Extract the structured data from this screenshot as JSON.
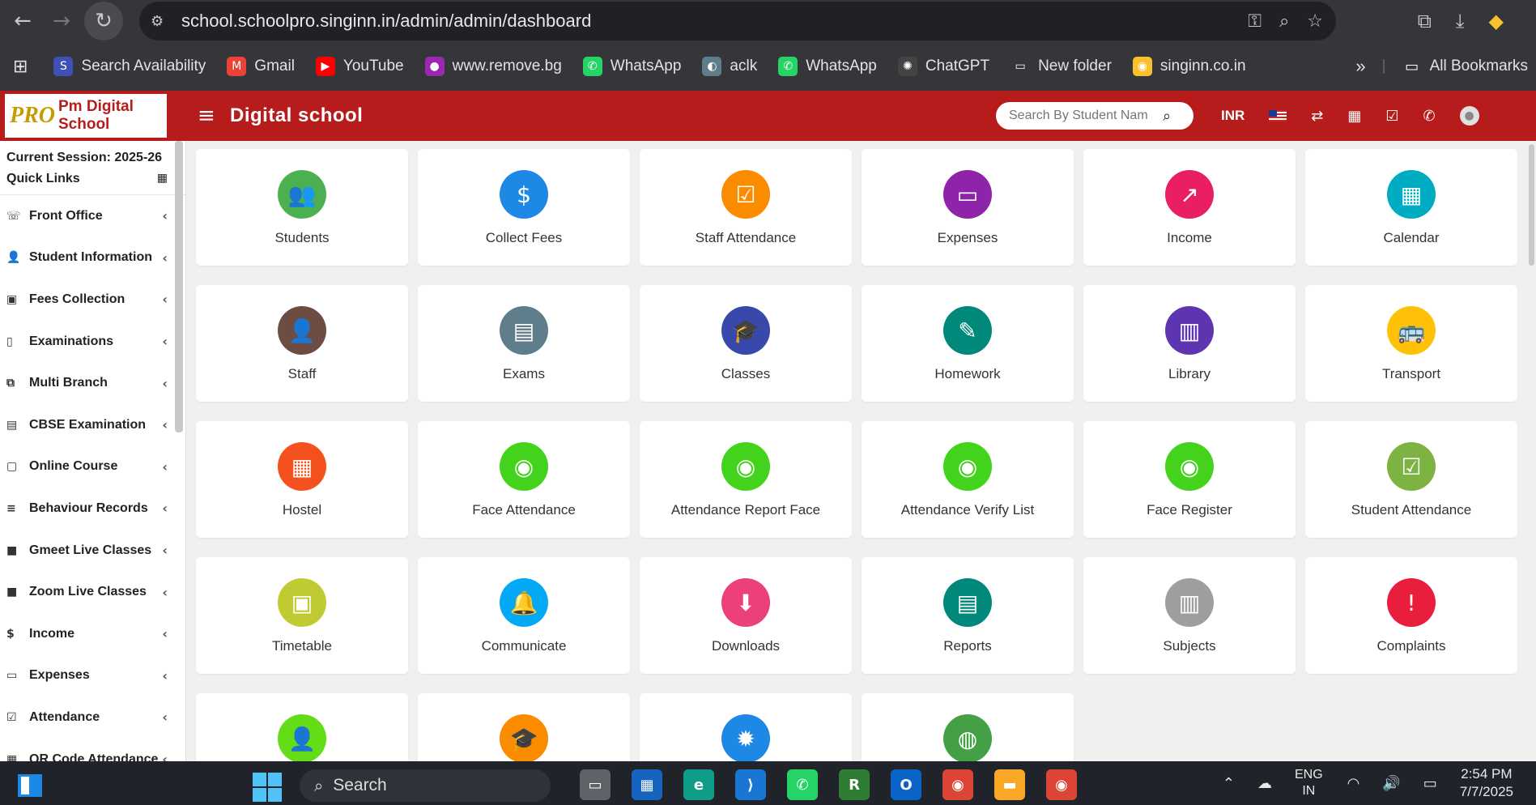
{
  "browser": {
    "url": "school.schoolpro.singinn.in/admin/admin/dashboard",
    "bookmarks": [
      {
        "label": "Search Availability",
        "color": "#3f51b5",
        "icon": "S"
      },
      {
        "label": "Gmail",
        "color": "#ea4335",
        "icon": "M"
      },
      {
        "label": "YouTube",
        "color": "#ff0000",
        "icon": "▶"
      },
      {
        "label": "www.remove.bg",
        "color": "#9c27b0",
        "icon": "●"
      },
      {
        "label": "WhatsApp",
        "color": "#25d366",
        "icon": "✆"
      },
      {
        "label": "aclk",
        "color": "#607d8b",
        "icon": "◐"
      },
      {
        "label": "WhatsApp",
        "color": "#25d366",
        "icon": "✆"
      },
      {
        "label": "ChatGPT",
        "color": "#444444",
        "icon": "✺"
      },
      {
        "label": "New folder",
        "color": "#35363a",
        "icon": "▭"
      },
      {
        "label": "singinn.co.in",
        "color": "#fbc02d",
        "icon": "◉"
      }
    ],
    "overflow": "»",
    "all_bookmarks": "All Bookmarks"
  },
  "header": {
    "logo_mark": "PRO",
    "logo_text": "Pm Digital School",
    "title": "Digital school",
    "search_placeholder": "Search By Student Nam",
    "currency": "INR"
  },
  "sidebar": {
    "session": "Current Session: 2025-26",
    "quick_links": "Quick Links",
    "items": [
      {
        "label": "Front Office",
        "icon": "☏"
      },
      {
        "label": "Student Information",
        "icon": "👤"
      },
      {
        "label": "Fees Collection",
        "icon": "▣"
      },
      {
        "label": "Examinations",
        "icon": "▯"
      },
      {
        "label": "Multi Branch",
        "icon": "⧉"
      },
      {
        "label": "CBSE Examination",
        "icon": "▤"
      },
      {
        "label": "Online Course",
        "icon": "▢"
      },
      {
        "label": "Behaviour Records",
        "icon": "≡"
      },
      {
        "label": "Gmeet Live Classes",
        "icon": "■"
      },
      {
        "label": "Zoom Live Classes",
        "icon": "■"
      },
      {
        "label": "Income",
        "icon": "$"
      },
      {
        "label": "Expenses",
        "icon": "▭"
      },
      {
        "label": "Attendance",
        "icon": "☑"
      },
      {
        "label": "QR Code Attendance",
        "icon": "▦"
      }
    ]
  },
  "tiles": [
    {
      "label": "Students",
      "color": "#4caf50",
      "icon": "👥"
    },
    {
      "label": "Collect Fees",
      "color": "#1e88e5",
      "icon": "$"
    },
    {
      "label": "Staff Attendance",
      "color": "#fb8c00",
      "icon": "☑"
    },
    {
      "label": "Expenses",
      "color": "#8e24aa",
      "icon": "▭"
    },
    {
      "label": "Income",
      "color": "#e91e63",
      "icon": "↗"
    },
    {
      "label": "Calendar",
      "color": "#00acc1",
      "icon": "▦"
    },
    {
      "label": "Staff",
      "color": "#6d4c41",
      "icon": "👤"
    },
    {
      "label": "Exams",
      "color": "#607d8b",
      "icon": "▤"
    },
    {
      "label": "Classes",
      "color": "#3949ab",
      "icon": "🎓"
    },
    {
      "label": "Homework",
      "color": "#00897b",
      "icon": "✎"
    },
    {
      "label": "Library",
      "color": "#5e35b1",
      "icon": "▥"
    },
    {
      "label": "Transport",
      "color": "#ffc107",
      "icon": "🚌"
    },
    {
      "label": "Hostel",
      "color": "#f4511e",
      "icon": "▦"
    },
    {
      "label": "Face Attendance",
      "color": "#43d31c",
      "icon": "◉"
    },
    {
      "label": "Attendance Report Face",
      "color": "#43d31c",
      "icon": "◉"
    },
    {
      "label": "Attendance Verify List",
      "color": "#43d31c",
      "icon": "◉"
    },
    {
      "label": "Face Register",
      "color": "#43d31c",
      "icon": "◉"
    },
    {
      "label": "Student Attendance",
      "color": "#7cb342",
      "icon": "☑"
    },
    {
      "label": "Timetable",
      "color": "#c0ca33",
      "icon": "▣"
    },
    {
      "label": "Communicate",
      "color": "#03a9f4",
      "icon": "🔔"
    },
    {
      "label": "Downloads",
      "color": "#ec407a",
      "icon": "⬇"
    },
    {
      "label": "Reports",
      "color": "#00897b",
      "icon": "▤"
    },
    {
      "label": "Subjects",
      "color": "#9e9e9e",
      "icon": "▥"
    },
    {
      "label": "Complaints",
      "color": "#e91e3c",
      "icon": "!"
    },
    {
      "label": "",
      "color": "#64dd17",
      "icon": "👤"
    },
    {
      "label": "",
      "color": "#fb8c00",
      "icon": "🎓"
    },
    {
      "label": "",
      "color": "#1e88e5",
      "icon": "✹"
    },
    {
      "label": "",
      "color": "#43a047",
      "icon": "◍"
    }
  ],
  "taskbar": {
    "search": "Search",
    "apps": [
      {
        "name": "task-view",
        "color": "#5f6368",
        "glyph": "▭"
      },
      {
        "name": "store",
        "color": "#1565c0",
        "glyph": "▦"
      },
      {
        "name": "edge",
        "color": "#0f9d8a",
        "glyph": "e"
      },
      {
        "name": "vscode",
        "color": "#1976d2",
        "glyph": "⟩"
      },
      {
        "name": "whatsapp",
        "color": "#25d366",
        "glyph": "✆"
      },
      {
        "name": "app-r",
        "color": "#2e7d32",
        "glyph": "R"
      },
      {
        "name": "outlook",
        "color": "#0a64c8",
        "glyph": "O"
      },
      {
        "name": "chrome",
        "color": "#db4437",
        "glyph": "◉"
      },
      {
        "name": "explorer",
        "color": "#f9a825",
        "glyph": "▬"
      },
      {
        "name": "chrome-2",
        "color": "#db4437",
        "glyph": "◉"
      }
    ],
    "lang_top": "ENG",
    "lang_bottom": "IN",
    "time": "2:54 PM",
    "date": "7/7/2025"
  }
}
